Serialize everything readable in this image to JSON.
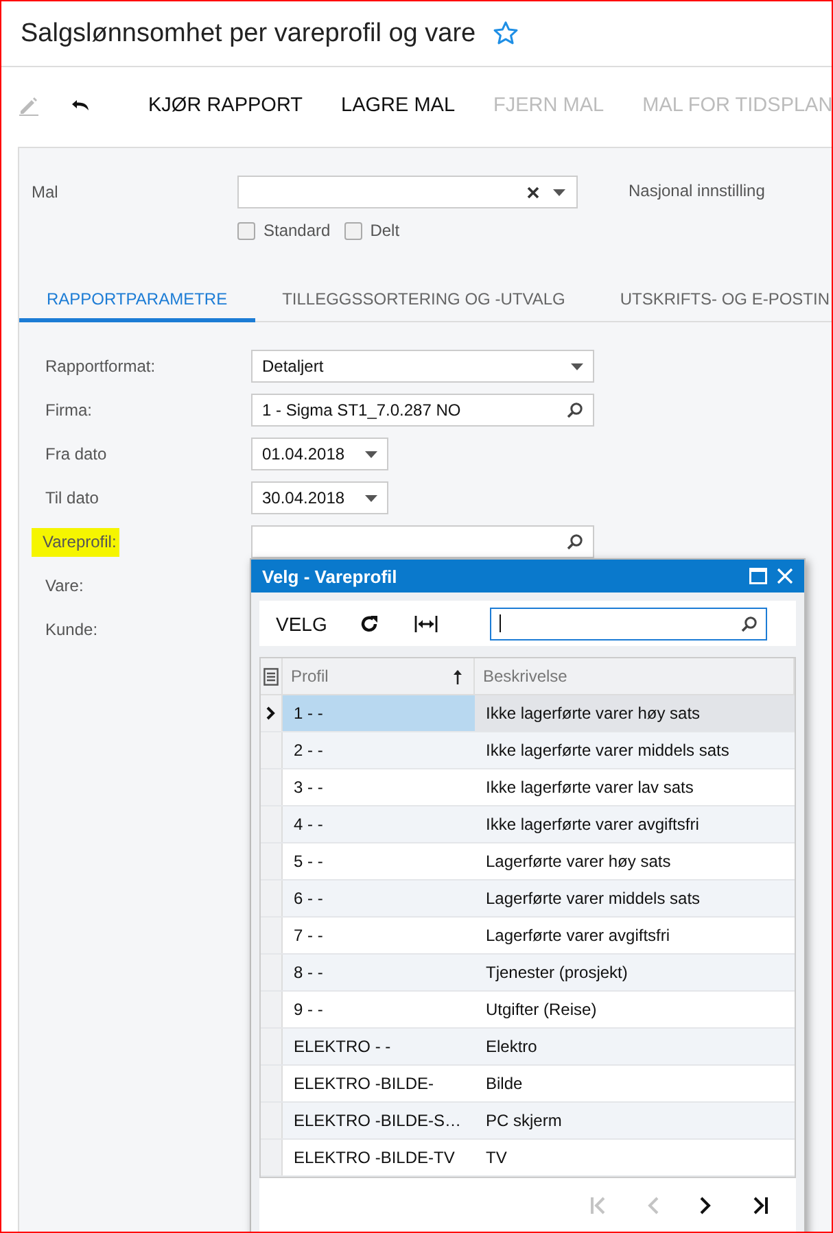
{
  "page": {
    "title": "Salgslønnsomhet per vareprofil og vare",
    "favorite": false
  },
  "toolbar": [
    {
      "kind": "edit",
      "disabled": true
    },
    {
      "kind": "undo",
      "disabled": false
    },
    {
      "kind": "text",
      "label": "KJØR RAPPORT",
      "disabled": false
    },
    {
      "kind": "text",
      "label": "LAGRE MAL",
      "disabled": false
    },
    {
      "kind": "text",
      "label": "FJERN MAL",
      "disabled": true
    },
    {
      "kind": "text",
      "label": "MAL FOR TIDSPLAN",
      "disabled": true
    }
  ],
  "template": {
    "label": "Mal",
    "national_label": "Nasjonal innstilling",
    "checkboxes": [
      {
        "label": "Standard",
        "checked": false
      },
      {
        "label": "Delt",
        "checked": false
      }
    ]
  },
  "tabs": [
    {
      "label": "RAPPORTPARAMETRE",
      "selected": true
    },
    {
      "label": "TILLEGGSSORTERING OG -UTVALG",
      "selected": false
    },
    {
      "label": "UTSKRIFTS- OG E-POSTIN",
      "selected": false
    }
  ],
  "parameters": [
    {
      "label": "Rapportformat:",
      "kind": "select",
      "value": "Detaljert",
      "highlighted": false
    },
    {
      "label": "Firma:",
      "kind": "lookup",
      "value": "1 - Sigma ST1_7.0.287 NO",
      "highlighted": false
    },
    {
      "label": "Fra dato",
      "kind": "date",
      "value": "01.04.2018",
      "highlighted": false
    },
    {
      "label": "Til dato",
      "kind": "date",
      "value": "30.04.2018",
      "highlighted": false
    },
    {
      "label": "Vareprofil:",
      "kind": "lookup",
      "highlighted": true
    },
    {
      "label": "Vare:",
      "kind": "plain",
      "highlighted": false
    },
    {
      "label": "Kunde:",
      "kind": "plain",
      "highlighted": false
    }
  ],
  "popup": {
    "title": "Velg - Vareprofil",
    "select_label": "VELG",
    "search": {
      "focused": true
    },
    "columns": [
      {
        "label": "Profil",
        "sorted_ascending": true
      },
      {
        "label": "Beskrivelse",
        "sorted_ascending": false
      }
    ],
    "rows": [
      {
        "profile": "1 - -",
        "description": "Ikke lagerførte varer høy sats",
        "selected": true
      },
      {
        "profile": "2 - -",
        "description": "Ikke lagerførte varer middels sats",
        "selected": false
      },
      {
        "profile": "3 - -",
        "description": "Ikke lagerførte varer lav sats",
        "selected": false
      },
      {
        "profile": "4 - -",
        "description": "Ikke lagerførte varer avgiftsfri",
        "selected": false
      },
      {
        "profile": "5 - -",
        "description": "Lagerførte varer høy sats",
        "selected": false
      },
      {
        "profile": "6 - -",
        "description": "Lagerførte varer middels sats",
        "selected": false
      },
      {
        "profile": "7 - -",
        "description": "Lagerførte varer avgiftsfri",
        "selected": false
      },
      {
        "profile": "8 - -",
        "description": "Tjenester (prosjekt)",
        "selected": false
      },
      {
        "profile": "9 - -",
        "description": "Utgifter (Reise)",
        "selected": false
      },
      {
        "profile": "ELEKTRO - -",
        "description": "Elektro",
        "selected": false
      },
      {
        "profile": "ELEKTRO -BILDE-",
        "description": "Bilde",
        "selected": false
      },
      {
        "profile": "ELEKTRO -BILDE-S…",
        "description": "PC skjerm",
        "selected": false
      },
      {
        "profile": "ELEKTRO -BILDE-TV",
        "description": "TV",
        "selected": false
      }
    ],
    "pager": [
      {
        "kind": "first",
        "disabled": true
      },
      {
        "kind": "prev",
        "disabled": true
      },
      {
        "kind": "next",
        "disabled": false
      },
      {
        "kind": "last",
        "disabled": false
      }
    ]
  }
}
